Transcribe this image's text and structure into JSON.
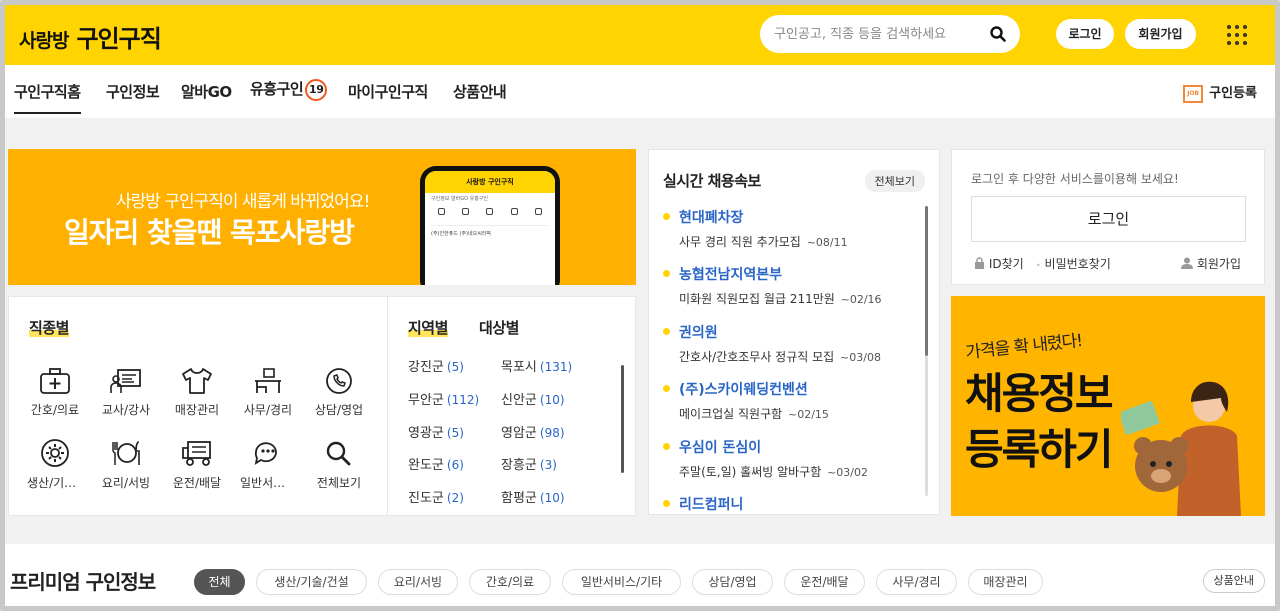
{
  "header": {
    "logo_small": "사랑방",
    "logo_big": "구인구직",
    "search_placeholder": "구인공고, 직종 등을 검색하세요",
    "login_label": "로그인",
    "signup_label": "회원가입"
  },
  "nav": {
    "tabs": [
      {
        "label": "구인구직홈"
      },
      {
        "label": "구인정보"
      },
      {
        "label": "알바GO"
      },
      {
        "label": "유흥구인"
      },
      {
        "label": "마이구인구직"
      },
      {
        "label": "상품안내"
      }
    ],
    "badge": "19",
    "job_register_label": "구인등록",
    "job_icon_text": "JOB"
  },
  "banner": {
    "sub": "사랑방 구인구직이 새롭게 바뀌었어요!",
    "main": "일자리 찾을땐 목포사랑방",
    "phone_title": "사랑방 구인구직",
    "phone_tabs": "구인정보  알바GO  유흥구인",
    "phone_row1": "(주)인한퓨드        (주)네오씨라픽"
  },
  "categories": {
    "title": "직종별",
    "items": [
      {
        "label": "간호/의료",
        "icon": "medical-kit-icon"
      },
      {
        "label": "교사/강사",
        "icon": "teacher-board-icon"
      },
      {
        "label": "매장관리",
        "icon": "shirt-icon"
      },
      {
        "label": "사무/경리",
        "icon": "office-desk-icon"
      },
      {
        "label": "상담/영업",
        "icon": "phone-chat-icon"
      },
      {
        "label": "생산/기술/건설",
        "icon": "gear-icon"
      },
      {
        "label": "요리/서빙",
        "icon": "dish-icon"
      },
      {
        "label": "운전/배달",
        "icon": "truck-icon"
      },
      {
        "label": "일반서비스/기타",
        "icon": "chat-bubble-icon"
      },
      {
        "label": "전체보기",
        "icon": "search-icon"
      }
    ]
  },
  "regions": {
    "tab_region": "지역별",
    "tab_target": "대상별",
    "items": [
      {
        "name": "강진군",
        "count": "(5)"
      },
      {
        "name": "목포시",
        "count": "(131)"
      },
      {
        "name": "무안군",
        "count": "(112)"
      },
      {
        "name": "신안군",
        "count": "(10)"
      },
      {
        "name": "영광군",
        "count": "(5)"
      },
      {
        "name": "영암군",
        "count": "(98)"
      },
      {
        "name": "완도군",
        "count": "(6)"
      },
      {
        "name": "장흥군",
        "count": "(3)"
      },
      {
        "name": "진도군",
        "count": "(2)"
      },
      {
        "name": "함평군",
        "count": "(10)"
      }
    ]
  },
  "live": {
    "title": "실시간 채용속보",
    "more": "전체보기",
    "items": [
      {
        "company": "현대폐차장",
        "desc": "사무 경리 직원 추가모집",
        "date": "~08/11"
      },
      {
        "company": "농협전남지역본부",
        "desc": "미화원 직원모집 월급 211만원",
        "date": "~02/16"
      },
      {
        "company": "권의원",
        "desc": "간호사/간호조무사 정규직 모집",
        "date": "~03/08"
      },
      {
        "company": "(주)스카이웨딩컨벤션",
        "desc": "메이크업실 직원구함",
        "date": "~02/15"
      },
      {
        "company": "우심이 돈심이",
        "desc": "주말(토,일) 홀써빙 알바구함",
        "date": "~03/02"
      },
      {
        "company": "리드컴퍼니",
        "desc": "",
        "date": ""
      }
    ]
  },
  "login_box": {
    "message": "로그인 후 다양한 서비스를이용해 보세요!",
    "button": "로그인",
    "find_id": "ID찾기",
    "find_pw": "비밀번호찾기",
    "join": "회원가입"
  },
  "ad": {
    "line1": "가격을 확 내렸다!",
    "line2a": "채용정보",
    "line2b": "등록하기"
  },
  "premium": {
    "title": "프리미엄 구인정보",
    "chips": [
      "전체",
      "생산/기술/건설",
      "요리/서빙",
      "간호/의료",
      "일반서비스/기타",
      "상담/영업",
      "운전/배달",
      "사무/경리",
      "매장관리"
    ],
    "product_btn": "상품안내"
  },
  "colors": {
    "brand_yellow": "#ffd400",
    "banner_orange": "#ffb000",
    "link_blue": "#2a66c8",
    "badge_orange": "#ef5a22"
  }
}
